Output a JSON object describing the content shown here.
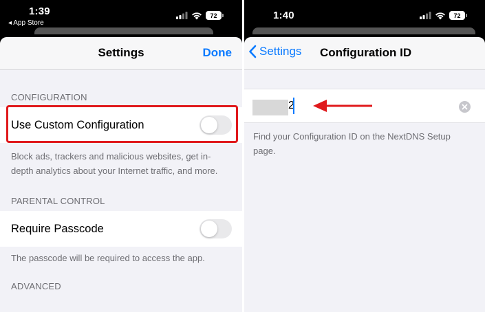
{
  "left": {
    "status": {
      "time": "1:39",
      "back_app": "◂ App Store",
      "battery": "72"
    },
    "nav": {
      "title": "Settings",
      "done_label": "Done"
    },
    "sections": {
      "configuration": {
        "header": "CONFIGURATION",
        "row_label": "Use Custom Configuration",
        "toggle_on": false,
        "footer": "Block ads, trackers and malicious websites, get in-depth analytics about your Internet traffic, and more."
      },
      "parental": {
        "header": "PARENTAL CONTROL",
        "row_label": "Require Passcode",
        "toggle_on": false,
        "footer": "The passcode will be required to access the app."
      },
      "advanced": {
        "header": "ADVANCED"
      }
    }
  },
  "right": {
    "status": {
      "time": "1:40",
      "battery": "72"
    },
    "nav": {
      "back_label": "Settings",
      "title": "Configuration ID"
    },
    "input": {
      "visible_value": "2"
    },
    "footer": "Find your Configuration ID on the NextDNS Setup page."
  },
  "colors": {
    "accent": "#0a7aff",
    "annotation": "#e0191c",
    "grouped_bg": "#f2f2f7"
  }
}
